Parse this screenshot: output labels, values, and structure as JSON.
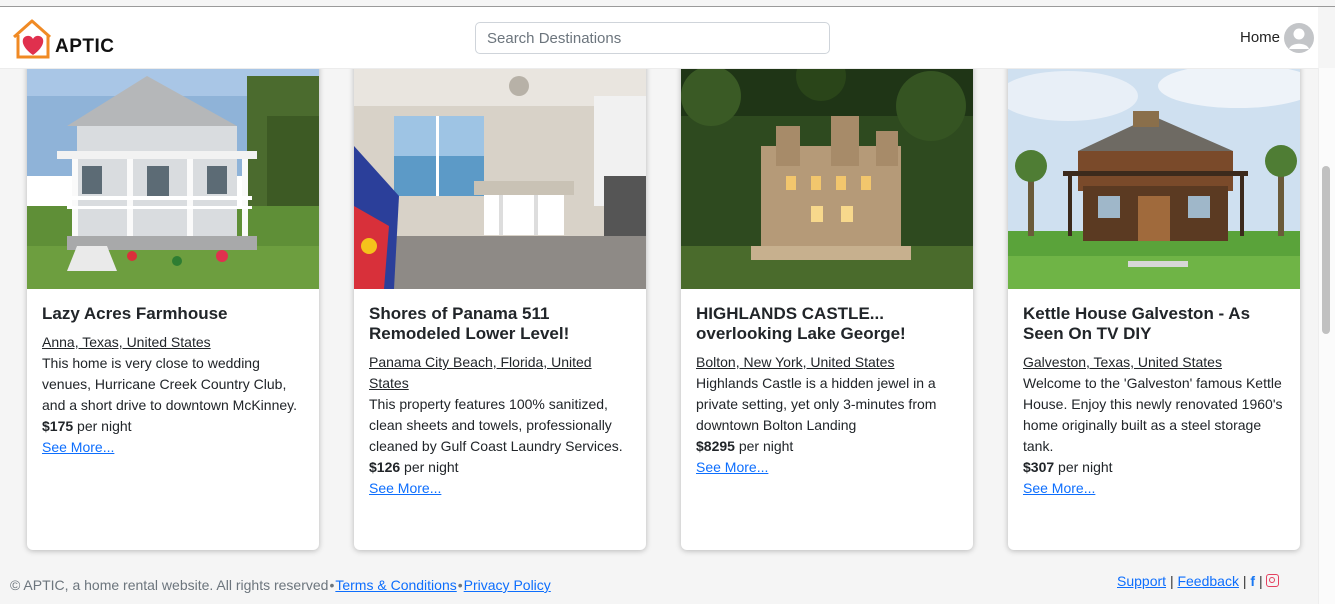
{
  "header": {
    "logo_text": "APTIC",
    "search_placeholder": "Search Destinations",
    "home_label": "Home"
  },
  "listings": [
    {
      "title": "Lazy Acres Farmhouse",
      "location": "Anna, Texas, United States",
      "description": "This home is very close to wedding venues, Hurricane Creek Country Club, and a short drive to downtown McKinney.",
      "price": "$175",
      "price_suffix": " per night",
      "link": "See More..."
    },
    {
      "title": "Shores of Panama 511 Remodeled Lower Level!",
      "location": "Panama City Beach, Florida, United States",
      "description": "This property features 100% sanitized, clean sheets and towels, professionally cleaned by Gulf Coast Laundry Services.",
      "price": "$126",
      "price_suffix": " per night",
      "link": "See More..."
    },
    {
      "title": "HIGHLANDS CASTLE... overlooking Lake George!",
      "location": "Bolton, New York, United States",
      "description": "Highlands Castle is a hidden jewel in a private setting, yet only 3-minutes from downtown Bolton Landing",
      "price": "$8295",
      "price_suffix": " per night",
      "link": "See More..."
    },
    {
      "title": "Kettle House Galveston - As Seen On TV DIY",
      "location": "Galveston, Texas, United States",
      "description": "Welcome to the 'Galveston' famous Kettle House. Enjoy this newly renovated 1960's home originally built as a steel storage tank.",
      "price": "$307",
      "price_suffix": " per night",
      "link": "See More..."
    }
  ],
  "footer": {
    "copyright": "© APTIC, a home rental website. All rights reserved",
    "separator": "•",
    "terms": "Terms & Conditions",
    "privacy": "Privacy Policy",
    "support": "Support",
    "feedback": "Feedback",
    "pipe": "|",
    "facebook_glyph": "f"
  },
  "colors": {
    "link": "#0d6efd",
    "logo_heart": "#e0304e",
    "logo_house": "#f08a24"
  }
}
